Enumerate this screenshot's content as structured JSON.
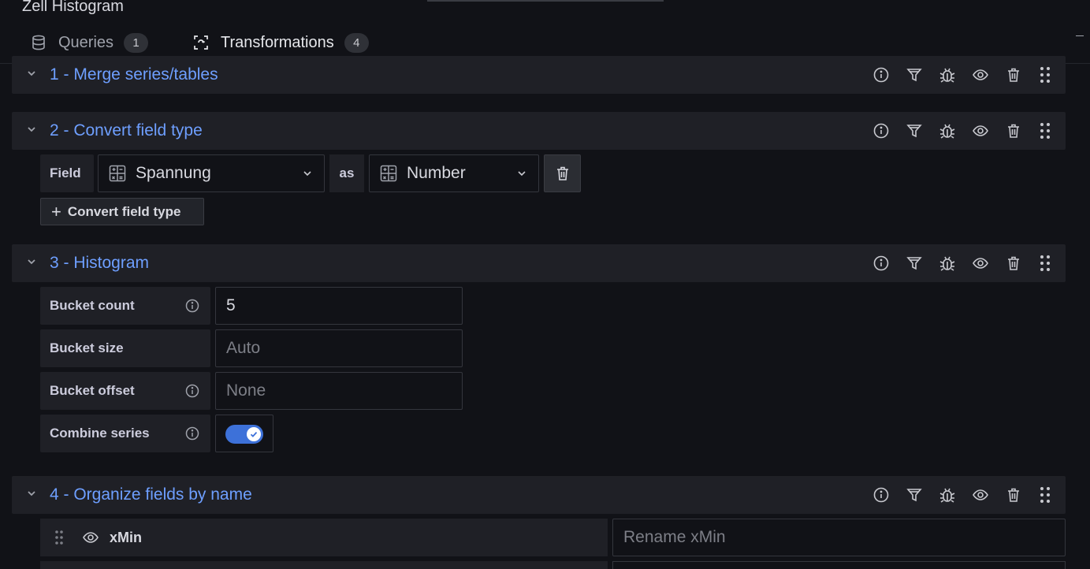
{
  "panel": {
    "title": "Zell Histogram"
  },
  "tabs": [
    {
      "label": "Queries",
      "count": "1"
    },
    {
      "label": "Transformations",
      "count": "4"
    }
  ],
  "transformations": [
    {
      "title": "1 - Merge series/tables"
    },
    {
      "title": "2 - Convert field type"
    },
    {
      "title": "3 - Histogram"
    },
    {
      "title": "4 - Organize fields by name"
    }
  ],
  "convert": {
    "field_label": "Field",
    "field_value": "Spannung",
    "as_label": "as",
    "type_value": "Number",
    "add_label": "Convert field type"
  },
  "histogram": {
    "bucket_count_label": "Bucket count",
    "bucket_count_value": "5",
    "bucket_size_label": "Bucket size",
    "bucket_size_placeholder": "Auto",
    "bucket_offset_label": "Bucket offset",
    "bucket_offset_placeholder": "None",
    "combine_label": "Combine series",
    "combine_enabled": true
  },
  "organize": {
    "field_name": "xMin",
    "rename_placeholder": "Rename xMin"
  },
  "colors": {
    "accent_blue": "#6e9fff",
    "tab_underline": "#f26a2f",
    "toggle_on": "#3d71d9"
  }
}
